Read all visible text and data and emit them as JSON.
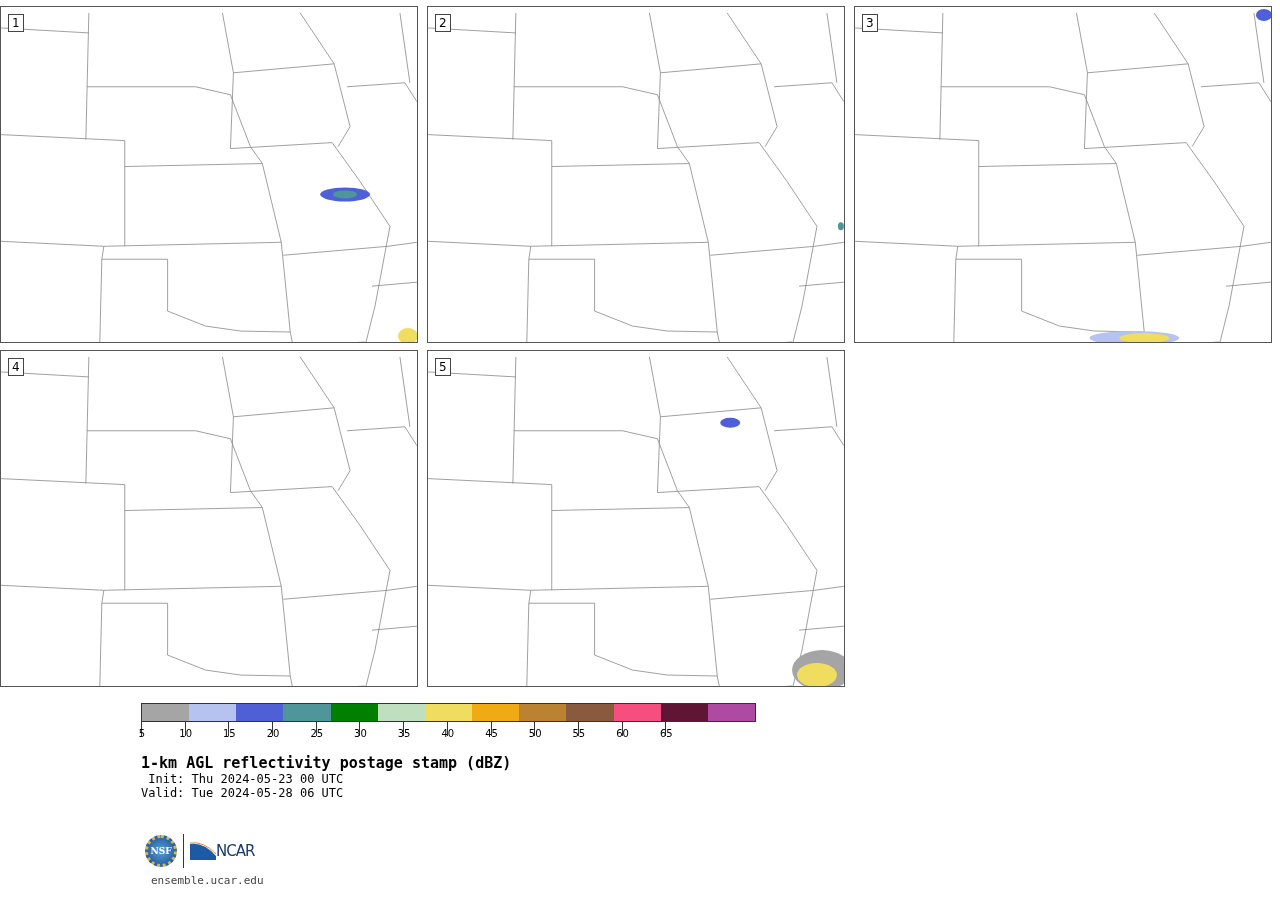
{
  "panels": [
    {
      "label": "1"
    },
    {
      "label": "2"
    },
    {
      "label": "3"
    },
    {
      "label": "4"
    },
    {
      "label": "5"
    }
  ],
  "colorbar": {
    "colors": [
      {
        "color": "#a5a5a5"
      },
      {
        "color": "#b6c2ef"
      },
      {
        "color": "#4f5fd6"
      },
      {
        "color": "#4f969b"
      },
      {
        "color": "#007f00"
      },
      {
        "color": "#bfdfbf"
      },
      {
        "color": "#f0dc5f"
      },
      {
        "color": "#f0aa15"
      },
      {
        "color": "#bb8232"
      },
      {
        "color": "#8a5a3e"
      },
      {
        "color": "#f44f7e"
      },
      {
        "color": "#601535"
      },
      {
        "color": "#ae4aa2"
      }
    ],
    "ticks": [
      "5",
      "10",
      "15",
      "20",
      "25",
      "30",
      "35",
      "40",
      "45",
      "50",
      "55",
      "60",
      "65"
    ]
  },
  "title": "1-km AGL reflectivity postage stamp (dBZ)",
  "init": " Init: Thu 2024-05-23 00 UTC",
  "valid": "Valid: Tue 2024-05-28 06 UTC",
  "logo": {
    "nsf": "NSF",
    "ncar": "NCAR"
  },
  "url": "ensemble.ucar.edu"
}
